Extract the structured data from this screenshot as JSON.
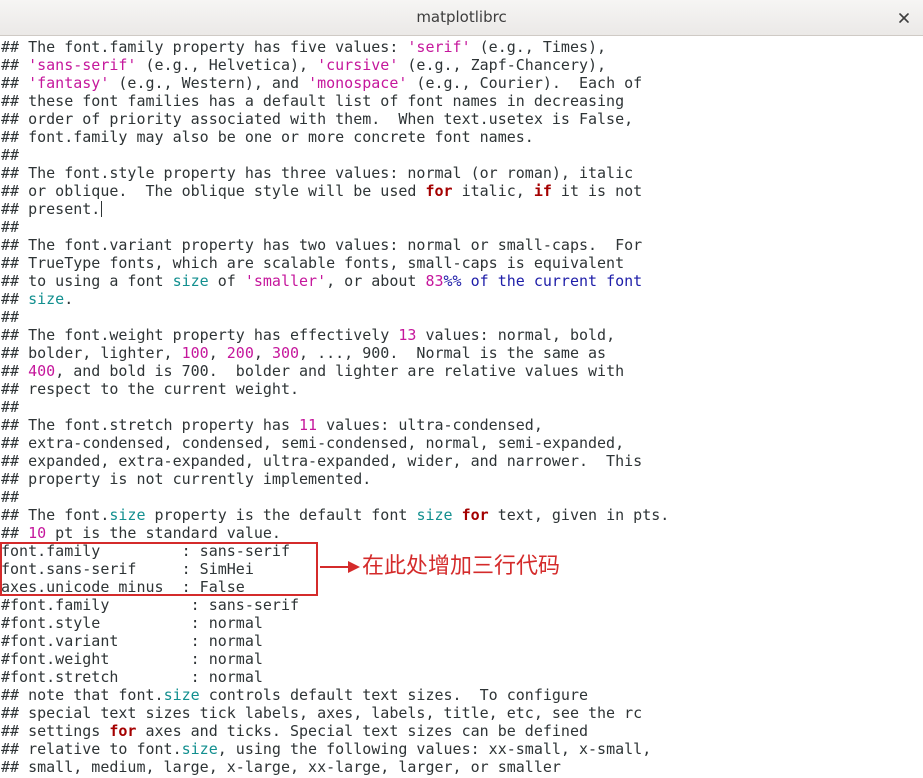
{
  "window": {
    "title": "matplotlibrc",
    "close_symbol": "×"
  },
  "editor": {
    "lines": [
      [
        [
          "c",
          "## The font.family property has five values: "
        ],
        [
          "s",
          "'serif'"
        ],
        [
          "c",
          " (e.g., Times),"
        ]
      ],
      [
        [
          "c",
          "## "
        ],
        [
          "s",
          "'sans-serif'"
        ],
        [
          "c",
          " (e.g., Helvetica), "
        ],
        [
          "s",
          "'cursive'"
        ],
        [
          "c",
          " (e.g., Zapf-Chancery),"
        ]
      ],
      [
        [
          "c",
          "## "
        ],
        [
          "s",
          "'fantasy'"
        ],
        [
          "c",
          " (e.g., Western), and "
        ],
        [
          "s",
          "'monospace'"
        ],
        [
          "c",
          " (e.g., Courier).  Each of"
        ]
      ],
      [
        [
          "c",
          "## these font families has a default list of font names in decreasing"
        ]
      ],
      [
        [
          "c",
          "## order of priority associated with them.  When text.usetex is False,"
        ]
      ],
      [
        [
          "c",
          "## font.family may also be one or more concrete font names."
        ]
      ],
      [
        [
          "c",
          "##"
        ]
      ],
      [
        [
          "c",
          "## The font.style property has three values: normal (or roman), italic"
        ]
      ],
      [
        [
          "c",
          "## or oblique.  The oblique style will be used "
        ],
        [
          "k",
          "for"
        ],
        [
          "c",
          " italic, "
        ],
        [
          "k",
          "if"
        ],
        [
          "c",
          " it is not"
        ]
      ],
      [
        [
          "c",
          "## present."
        ],
        [
          "cursor",
          ""
        ]
      ],
      [
        [
          "c",
          "##"
        ]
      ],
      [
        [
          "c",
          "## The font.variant property has two values: normal or small-caps.  For"
        ]
      ],
      [
        [
          "c",
          "## TrueType fonts, which are scalable fonts, small-caps is equivalent"
        ]
      ],
      [
        [
          "c",
          "## to using a font "
        ],
        [
          "b",
          "size"
        ],
        [
          "c",
          " of "
        ],
        [
          "s",
          "'smaller'"
        ],
        [
          "c",
          ", or about "
        ],
        [
          "n",
          "83"
        ],
        [
          "p",
          "%% of the current font"
        ]
      ],
      [
        [
          "c",
          "## "
        ],
        [
          "b",
          "size"
        ],
        [
          "c",
          "."
        ]
      ],
      [
        [
          "c",
          "##"
        ]
      ],
      [
        [
          "c",
          "## The font.weight property has effectively "
        ],
        [
          "n",
          "13"
        ],
        [
          "c",
          " values: normal, bold,"
        ]
      ],
      [
        [
          "c",
          "## bolder, lighter, "
        ],
        [
          "n",
          "100"
        ],
        [
          "c",
          ", "
        ],
        [
          "n",
          "200"
        ],
        [
          "c",
          ", "
        ],
        [
          "n",
          "300"
        ],
        [
          "c",
          ", ..., 900.  Normal is the same as"
        ]
      ],
      [
        [
          "c",
          "## "
        ],
        [
          "n",
          "400"
        ],
        [
          "c",
          ", and bold is 700.  bolder and lighter are relative values with"
        ]
      ],
      [
        [
          "c",
          "## respect to the current weight."
        ]
      ],
      [
        [
          "c",
          "##"
        ]
      ],
      [
        [
          "c",
          "## The font.stretch property has "
        ],
        [
          "n",
          "11"
        ],
        [
          "c",
          " values: ultra-condensed,"
        ]
      ],
      [
        [
          "c",
          "## extra-condensed, condensed, semi-condensed, normal, semi-expanded,"
        ]
      ],
      [
        [
          "c",
          "## expanded, extra-expanded, ultra-expanded, wider, and narrower.  This"
        ]
      ],
      [
        [
          "c",
          "## property is not currently implemented."
        ]
      ],
      [
        [
          "c",
          "##"
        ]
      ],
      [
        [
          "c",
          "## The font."
        ],
        [
          "b",
          "size"
        ],
        [
          "c",
          " property is the default font "
        ],
        [
          "b",
          "size"
        ],
        [
          "c",
          " "
        ],
        [
          "k",
          "for"
        ],
        [
          "c",
          " text, given in pts."
        ]
      ],
      [
        [
          "c",
          "## "
        ],
        [
          "n",
          "10"
        ],
        [
          "c",
          " pt is the standard value."
        ]
      ],
      [
        [
          "c",
          "font.family         : sans-serif"
        ]
      ],
      [
        [
          "c",
          "font.sans-serif     : SimHei"
        ]
      ],
      [
        [
          "c",
          "axes.unicode_minus  : False"
        ]
      ],
      [
        [
          "c",
          "#font.family         : sans-serif"
        ]
      ],
      [
        [
          "c",
          "#font.style          : normal"
        ]
      ],
      [
        [
          "c",
          "#font.variant        : normal"
        ]
      ],
      [
        [
          "c",
          "#font.weight         : normal"
        ]
      ],
      [
        [
          "c",
          "#font.stretch        : normal"
        ]
      ],
      [
        [
          "c",
          "## note that font."
        ],
        [
          "b",
          "size"
        ],
        [
          "c",
          " controls default text sizes.  To configure"
        ]
      ],
      [
        [
          "c",
          "## special text sizes tick labels, axes, labels, title, etc, see the rc"
        ]
      ],
      [
        [
          "c",
          "## settings "
        ],
        [
          "k",
          "for"
        ],
        [
          "c",
          " axes and ticks. Special text sizes can be defined"
        ]
      ],
      [
        [
          "c",
          "## relative to font."
        ],
        [
          "b",
          "size"
        ],
        [
          "c",
          ", using the following values: xx-small, x-small,"
        ]
      ],
      [
        [
          "c",
          "## small, medium, large, x-large, xx-large, larger, or smaller"
        ]
      ]
    ]
  },
  "annotation": {
    "text": "在此处增加三行代码",
    "color": "#d42b2b"
  },
  "colors": {
    "string": "#c5179c",
    "keyword": "#a40000",
    "builtin": "#128f8f",
    "special": "#1d1da8",
    "text": "#2e3436"
  }
}
